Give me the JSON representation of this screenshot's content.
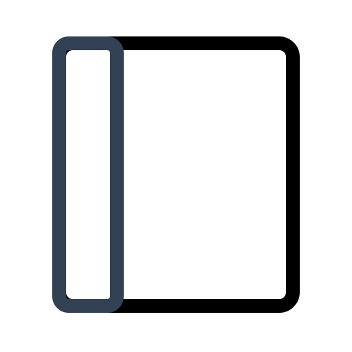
{
  "icon": {
    "name": "sidebar-panel-icon",
    "colors": {
      "background": "#ffffff",
      "outline": "#000000",
      "sidebar_accent": "#334155"
    }
  }
}
